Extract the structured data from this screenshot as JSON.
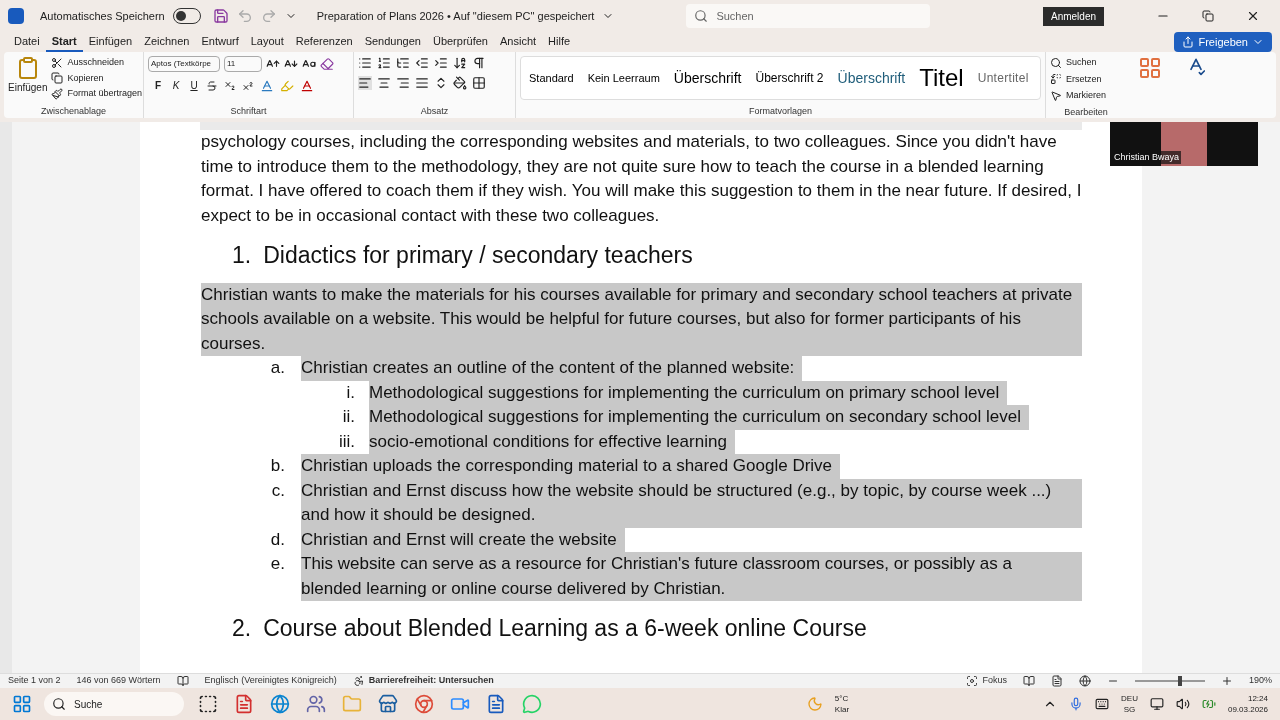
{
  "title_bar": {
    "autosave_label": "Automatisches Speichern",
    "autosave_on": false,
    "document_title": "Preparation of Plans 2026 • Auf \"diesem PC\" gespeichert",
    "search_placeholder": "Suchen",
    "sign_in": "Anmelden"
  },
  "menu_tabs": [
    {
      "label": "Datei",
      "selected": false
    },
    {
      "label": "Start",
      "selected": true
    },
    {
      "label": "Einfügen",
      "selected": false
    },
    {
      "label": "Zeichnen",
      "selected": false
    },
    {
      "label": "Entwurf",
      "selected": false
    },
    {
      "label": "Layout",
      "selected": false
    },
    {
      "label": "Referenzen",
      "selected": false
    },
    {
      "label": "Sendungen",
      "selected": false
    },
    {
      "label": "Überprüfen",
      "selected": false
    },
    {
      "label": "Ansicht",
      "selected": false
    },
    {
      "label": "Hilfe",
      "selected": false
    }
  ],
  "share_button": "Freigeben",
  "ribbon": {
    "clipboard": {
      "paste": "Einfügen",
      "items": [
        "Ausschneiden",
        "Kopieren",
        "Format übertragen"
      ],
      "label": "Zwischenablage"
    },
    "font": {
      "font_name": "Aptos (Textkörpe",
      "font_size": "11",
      "letters": [
        "F",
        "K",
        "U"
      ],
      "label": "Schriftart"
    },
    "paragraph": {
      "label": "Absatz"
    },
    "styles": {
      "items": [
        {
          "label": "Standard",
          "kind": "normal"
        },
        {
          "label": "Kein Leerraum",
          "kind": "normal"
        },
        {
          "label": "Überschrift",
          "kind": "heading1"
        },
        {
          "label": "Überschrift 2",
          "kind": "heading2"
        },
        {
          "label": "Überschrift",
          "kind": "accent"
        },
        {
          "label": "Titel",
          "kind": "title"
        },
        {
          "label": "Untertitel",
          "kind": "subtitle"
        }
      ],
      "label": "Formatvorlagen"
    },
    "editing": {
      "items": [
        "Suchen",
        "Ersetzen",
        "Markieren"
      ],
      "label": "Bearbeiten"
    }
  },
  "video": {
    "name": "Christian Bwaya"
  },
  "document": [
    {
      "kind": "paragraph",
      "highlighted": false,
      "text": "psychology courses, including the corresponding websites and materials, to two colleagues. Since you didn't have time to introduce them to the methodology, they are not quite sure how to teach the course in a blended learning format. I have offered to coach them if they wish. You will make this suggestion to them in the near future. If desired, I expect to be in occasional contact with these two colleagues."
    },
    {
      "kind": "heading",
      "number": "1.",
      "text": "Didactics for primary / secondary teachers"
    },
    {
      "kind": "paragraph",
      "highlighted": true,
      "text": "Christian wants to make the materials for his courses available for primary and secondary school teachers at private schools available on a website. This would be helpful for future courses, but also for former participants of his courses."
    },
    {
      "kind": "item",
      "marker": "a.",
      "highlighted": true,
      "text": "Christian creates an outline of the content of the planned website:",
      "children": [
        {
          "marker": "i.",
          "highlighted": true,
          "text": "Methodological suggestions for implementing the curriculum on primary school level"
        },
        {
          "marker": "ii.",
          "highlighted": true,
          "text": "Methodological suggestions for implementing the curriculum on secondary school level"
        },
        {
          "marker": "iii.",
          "highlighted": true,
          "text": "socio-emotional conditions for effective learning"
        }
      ]
    },
    {
      "kind": "item",
      "marker": "b.",
      "highlighted": true,
      "text": "Christian uploads the corresponding material to a shared Google Drive"
    },
    {
      "kind": "item",
      "marker": "c.",
      "highlighted": true,
      "text": "Christian and Ernst discuss how the website should be structured (e.g., by topic, by course week ...) and how it should be designed."
    },
    {
      "kind": "item",
      "marker": "d.",
      "highlighted": true,
      "text": "Christian and Ernst will create the website"
    },
    {
      "kind": "item",
      "marker": "e.",
      "highlighted": true,
      "text": "This website can serve as a resource for Christian's future classroom courses, or possibly as a blended learning or online course delivered by Christian."
    },
    {
      "kind": "heading",
      "number": "2.",
      "text": "Course about Blended Learning as a 6-week online Course"
    }
  ],
  "status_bar": {
    "page": "Seite 1 von 2",
    "words": "146 von 669 Wörtern",
    "language": "Englisch (Vereinigtes Königreich)",
    "accessibility": "Barrierefreiheit: Untersuchen",
    "focus": "Fokus",
    "zoom": "190%",
    "zoom_level": {
      "level": 0.65
    }
  },
  "taskbar": {
    "search_placeholder": "Suche",
    "temperature": "5°C",
    "weather": "Klar",
    "keyboard_lang": "DEU",
    "keyboard_layout": "SG",
    "time": "12:24",
    "date": "09.03.2026"
  }
}
